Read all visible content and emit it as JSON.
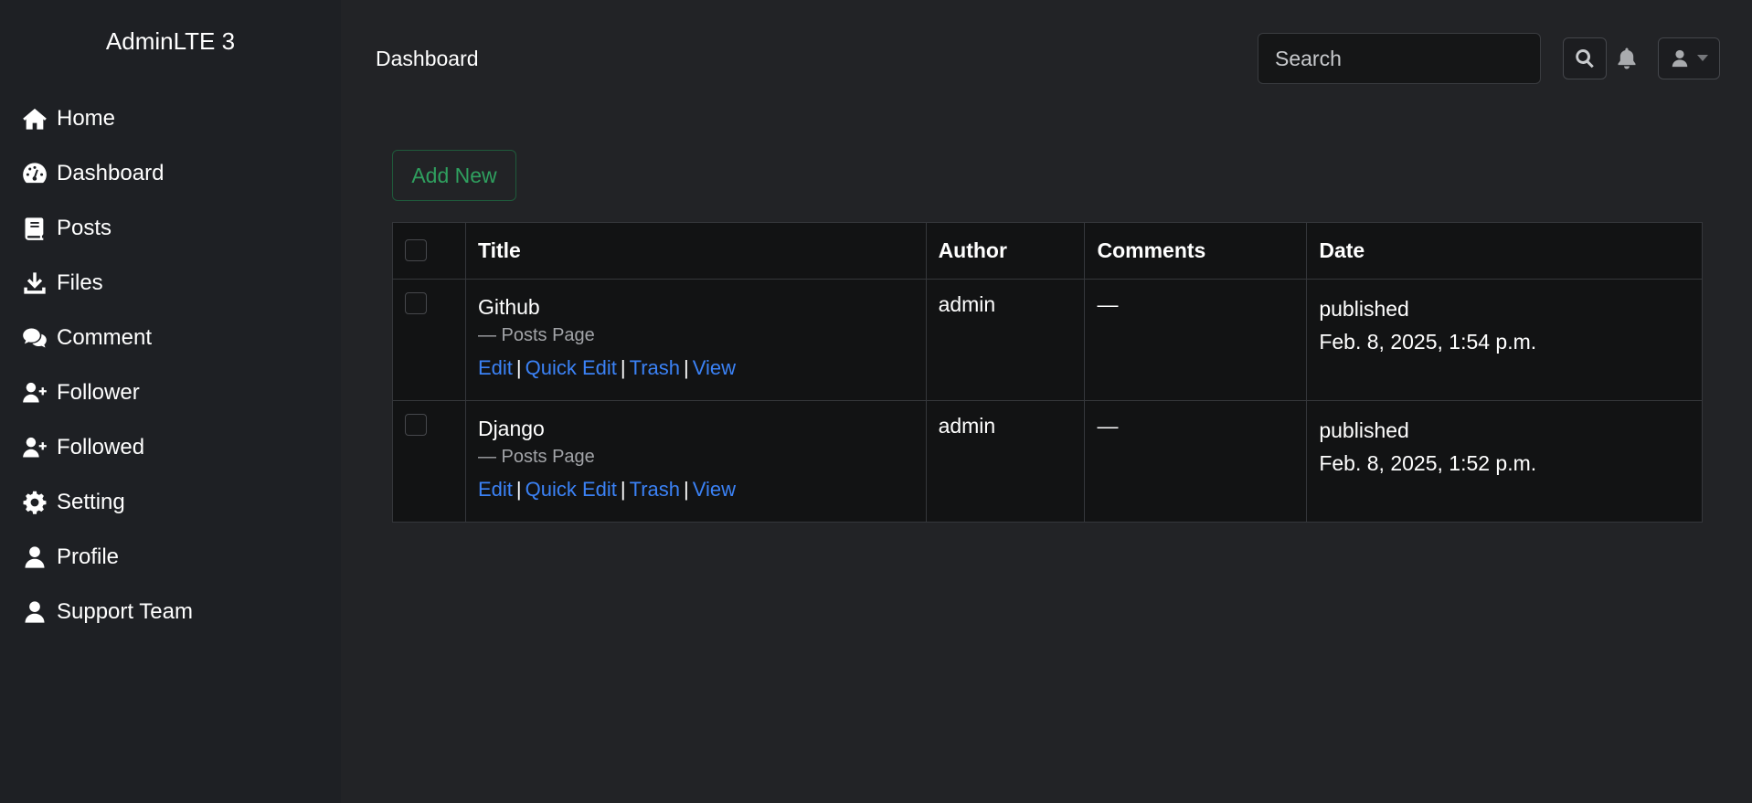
{
  "sidebar": {
    "brand": "AdminLTE 3",
    "items": [
      {
        "label": "Home",
        "icon": "home-icon"
      },
      {
        "label": "Dashboard",
        "icon": "gauge-icon"
      },
      {
        "label": "Posts",
        "icon": "book-icon"
      },
      {
        "label": "Files",
        "icon": "download-icon"
      },
      {
        "label": "Comment",
        "icon": "comments-icon"
      },
      {
        "label": "Follower",
        "icon": "user-plus-icon"
      },
      {
        "label": "Followed",
        "icon": "user-plus-icon"
      },
      {
        "label": "Setting",
        "icon": "gear-icon"
      },
      {
        "label": "Profile",
        "icon": "user-icon"
      },
      {
        "label": "Support Team",
        "icon": "user-icon"
      }
    ]
  },
  "topbar": {
    "title": "Dashboard",
    "search_placeholder": "Search"
  },
  "toolbar": {
    "add_new_label": "Add New"
  },
  "table": {
    "headers": [
      "Title",
      "Author",
      "Comments",
      "Date"
    ],
    "rows": [
      {
        "title": "Github",
        "subtitle": "— Posts Page",
        "actions": [
          "Edit",
          "Quick Edit",
          "Trash",
          "View"
        ],
        "author": "admin",
        "comments": "—",
        "status": "published",
        "date": "Feb. 8, 2025, 1:54 p.m."
      },
      {
        "title": "Django",
        "subtitle": "— Posts Page",
        "actions": [
          "Edit",
          "Quick Edit",
          "Trash",
          "View"
        ],
        "author": "admin",
        "comments": "—",
        "status": "published",
        "date": "Feb. 8, 2025, 1:52 p.m."
      }
    ]
  },
  "colors": {
    "background": "#222326",
    "sidebar": "#1e2024",
    "table": "#121314",
    "link": "#3b82f6",
    "success": "#2fa05f"
  }
}
